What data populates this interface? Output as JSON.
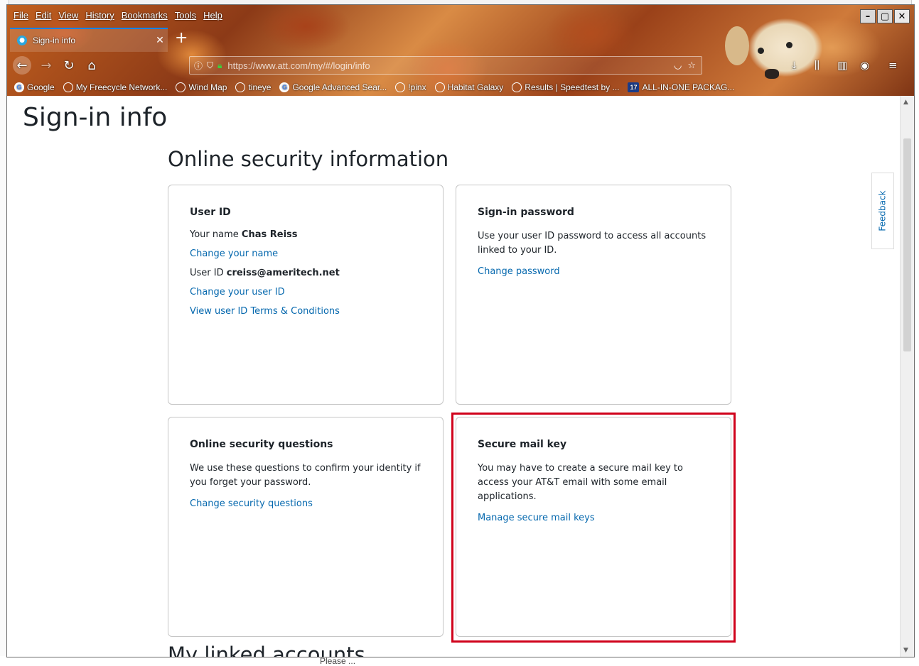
{
  "menu": [
    "File",
    "Edit",
    "View",
    "History",
    "Bookmarks",
    "Tools",
    "Help"
  ],
  "tab": {
    "title": "Sign-in info",
    "favicon": "att-globe-icon"
  },
  "navbar": {
    "url": "https://www.att.com/my/#/login/info"
  },
  "bookmarks": [
    {
      "label": "Google",
      "icon": "g"
    },
    {
      "label": "My Freecycle Network...",
      "icon": "globe"
    },
    {
      "label": "Wind Map",
      "icon": "globe"
    },
    {
      "label": "tineye",
      "icon": "globe"
    },
    {
      "label": "Google Advanced Sear...",
      "icon": "g"
    },
    {
      "label": "!pinx",
      "icon": "globe"
    },
    {
      "label": "Habitat Galaxy",
      "icon": "globe"
    },
    {
      "label": "Results | Speedtest by ...",
      "icon": "globe"
    },
    {
      "label": "ALL-IN-ONE PACKAG...",
      "icon": "17"
    }
  ],
  "page": {
    "title": "Sign-in info",
    "section_title": "Online security information",
    "linked_title": "My linked accounts",
    "feedback": "Feedback"
  },
  "cards": {
    "user_id": {
      "title": "User ID",
      "name_label": "Your name",
      "name_value": "Chas Reiss",
      "change_name": "Change your name",
      "uid_label": "User ID",
      "uid_value": "creiss@ameritech.net",
      "change_uid": "Change your user ID",
      "terms": "View user ID Terms & Conditions"
    },
    "password": {
      "title": "Sign-in password",
      "text": "Use your user ID password to access all accounts linked to your ID.",
      "link": "Change password"
    },
    "questions": {
      "title": "Online security questions",
      "text": "We use these questions to confirm your identity if you forget your password.",
      "link": "Change security questions"
    },
    "mail_key": {
      "title": "Secure mail key",
      "text": "You may have to create a secure mail key to access your AT&T email with some email applications.",
      "link": "Manage secure mail keys"
    }
  },
  "desktop": {
    "bottom_text": "Please ..."
  },
  "colors": {
    "link": "#0568ae",
    "highlight": "#d0021b",
    "tab_accent": "#0a84ff"
  }
}
